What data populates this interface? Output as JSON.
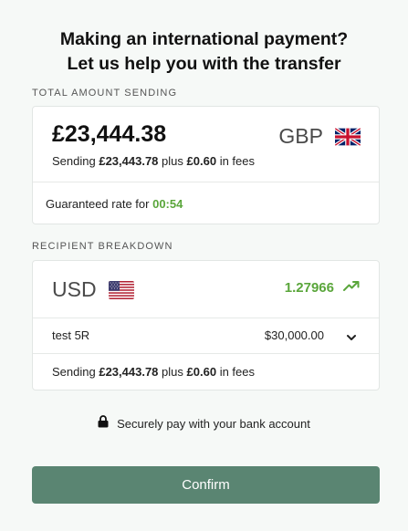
{
  "header": {
    "line1": "Making an international payment?",
    "line2": "Let us help you with the transfer"
  },
  "sending": {
    "section_label": "TOTAL AMOUNT SENDING",
    "amount": "£23,444.38",
    "currency": "GBP",
    "flag_icon": "uk-flag-icon",
    "sub_prefix": "Sending",
    "sub_amount": "£23,443.78",
    "sub_mid": "plus",
    "sub_fee": "£0.60",
    "sub_suffix": "in fees",
    "rate_prefix": "Guaranteed rate for",
    "rate_timer": "00:54"
  },
  "recipient": {
    "section_label": "RECIPIENT BREAKDOWN",
    "currency": "USD",
    "flag_icon": "us-flag-icon",
    "rate": "1.27966",
    "rate_icon": "trending-up-icon",
    "recipient_name": "test 5R",
    "recipient_amount": "$30,000.00",
    "expand_icon": "chevron-down-icon",
    "sub_prefix": "Sending",
    "sub_amount": "£23,443.78",
    "sub_mid": "plus",
    "sub_fee": "£0.60",
    "sub_suffix": "in fees"
  },
  "secure": {
    "icon": "lock-icon",
    "text": "Securely pay with your bank account"
  },
  "confirm_label": "Confirm",
  "colors": {
    "accent_green": "#5aa63b",
    "button": "#5a8572",
    "background": "#f6f9f7"
  }
}
